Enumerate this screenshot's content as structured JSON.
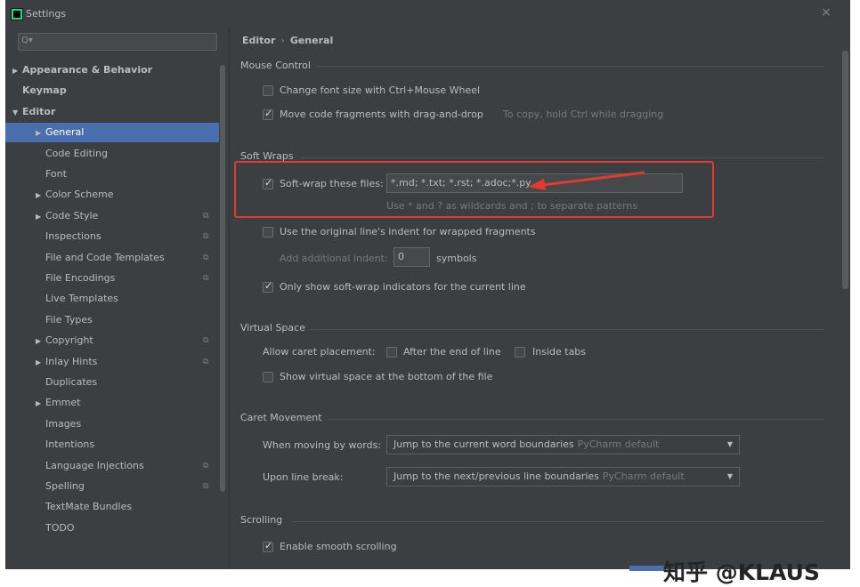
{
  "window": {
    "title": "Settings",
    "close_glyph": "×"
  },
  "search": {
    "icon": "Q▾",
    "placeholder": ""
  },
  "sidebar": {
    "items": [
      {
        "label": "Appearance & Behavior",
        "arrow": "▶",
        "bold": true,
        "copy": ""
      },
      {
        "label": "Keymap",
        "arrow": "",
        "bold": true,
        "copy": ""
      },
      {
        "label": "Editor",
        "arrow": "▼",
        "bold": true,
        "copy": ""
      },
      {
        "label": "General",
        "arrow": "▶",
        "bold": false,
        "copy": "",
        "selected": true
      },
      {
        "label": "Code Editing",
        "arrow": "",
        "bold": false,
        "copy": ""
      },
      {
        "label": "Font",
        "arrow": "",
        "bold": false,
        "copy": ""
      },
      {
        "label": "Color Scheme",
        "arrow": "▶",
        "bold": false,
        "copy": ""
      },
      {
        "label": "Code Style",
        "arrow": "▶",
        "bold": false,
        "copy": "⧉"
      },
      {
        "label": "Inspections",
        "arrow": "",
        "bold": false,
        "copy": "⧉"
      },
      {
        "label": "File and Code Templates",
        "arrow": "",
        "bold": false,
        "copy": "⧉"
      },
      {
        "label": "File Encodings",
        "arrow": "",
        "bold": false,
        "copy": "⧉"
      },
      {
        "label": "Live Templates",
        "arrow": "",
        "bold": false,
        "copy": ""
      },
      {
        "label": "File Types",
        "arrow": "",
        "bold": false,
        "copy": ""
      },
      {
        "label": "Copyright",
        "arrow": "▶",
        "bold": false,
        "copy": "⧉"
      },
      {
        "label": "Inlay Hints",
        "arrow": "▶",
        "bold": false,
        "copy": "⧉"
      },
      {
        "label": "Duplicates",
        "arrow": "",
        "bold": false,
        "copy": ""
      },
      {
        "label": "Emmet",
        "arrow": "▶",
        "bold": false,
        "copy": ""
      },
      {
        "label": "Images",
        "arrow": "",
        "bold": false,
        "copy": ""
      },
      {
        "label": "Intentions",
        "arrow": "",
        "bold": false,
        "copy": ""
      },
      {
        "label": "Language Injections",
        "arrow": "",
        "bold": false,
        "copy": "⧉"
      },
      {
        "label": "Spelling",
        "arrow": "",
        "bold": false,
        "copy": "⧉"
      },
      {
        "label": "TextMate Bundles",
        "arrow": "",
        "bold": false,
        "copy": ""
      },
      {
        "label": "TODO",
        "arrow": "",
        "bold": false,
        "copy": ""
      }
    ]
  },
  "breadcrumb": {
    "part1": "Editor",
    "separator": "›",
    "part2": "General"
  },
  "mouse_control": {
    "header": "Mouse Control",
    "font_size_label": "Change font size with Ctrl+Mouse Wheel",
    "font_size_checked": false,
    "drag_drop_label": "Move code fragments with drag-and-drop",
    "drag_drop_checked": true,
    "drag_drop_hint": "To copy, hold Ctrl while dragging"
  },
  "soft_wraps": {
    "header": "Soft Wraps",
    "wrap_files_label": "Soft-wrap these files:",
    "wrap_files_checked": true,
    "wrap_files_value": "*.md; *.txt; *.rst; *.adoc;*.py",
    "wrap_files_hint": "Use * and ? as wildcards and ; to separate patterns",
    "original_indent_label": "Use the original line's indent for wrapped fragments",
    "original_indent_checked": false,
    "additional_indent_label": "Add additional indent:",
    "additional_indent_value": "0",
    "additional_indent_unit": "symbols",
    "indicators_label": "Only show soft-wrap indicators for the current line",
    "indicators_checked": true
  },
  "virtual_space": {
    "header": "Virtual Space",
    "caret_placement_label": "Allow caret placement:",
    "after_end_label": "After the end of line",
    "after_end_checked": false,
    "inside_tabs_label": "Inside tabs",
    "inside_tabs_checked": false,
    "virtual_space_bottom_label": "Show virtual space at the bottom of the file",
    "virtual_space_bottom_checked": false
  },
  "caret_movement": {
    "header": "Caret Movement",
    "moving_words_label": "When moving by words:",
    "moving_words_value": "Jump to the current word boundaries",
    "moving_words_default": "PyCharm default",
    "line_break_label": "Upon line break:",
    "line_break_value": "Jump to the next/previous line boundaries",
    "line_break_default": "PyCharm default",
    "combo_arrow": "▼"
  },
  "scrolling": {
    "header": "Scrolling",
    "smooth_label": "Enable smooth scrolling",
    "smooth_checked": true
  },
  "watermark": {
    "text": "知乎 @KLAUS"
  },
  "colors": {
    "background": "#3c3f41",
    "selection": "#4b6eaf",
    "annotation": "#e4392f"
  }
}
